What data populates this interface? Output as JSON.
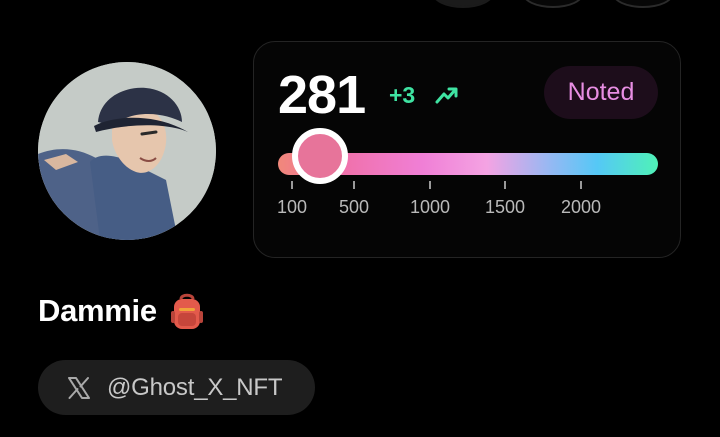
{
  "profile": {
    "name": "Dammie",
    "handle": "@Ghost_X_NFT",
    "avatar_icon": "avatar-image",
    "name_emoji_icon": "backpack-icon",
    "handle_icon": "x-logo-icon"
  },
  "score_card": {
    "score": "281",
    "delta": "+3",
    "trend_icon": "trending-up-icon",
    "status_badge": "Noted",
    "slider": {
      "value": 281,
      "tick_labels": [
        "100",
        "500",
        "1000",
        "1500",
        "2000"
      ]
    }
  },
  "colors": {
    "background": "#000000",
    "delta_green": "#3fe3a2",
    "badge_text": "#e88ee3",
    "badge_bg": "#1d0d1b",
    "thumb": "#e7749a",
    "pill_bg": "#1e1e1e"
  }
}
